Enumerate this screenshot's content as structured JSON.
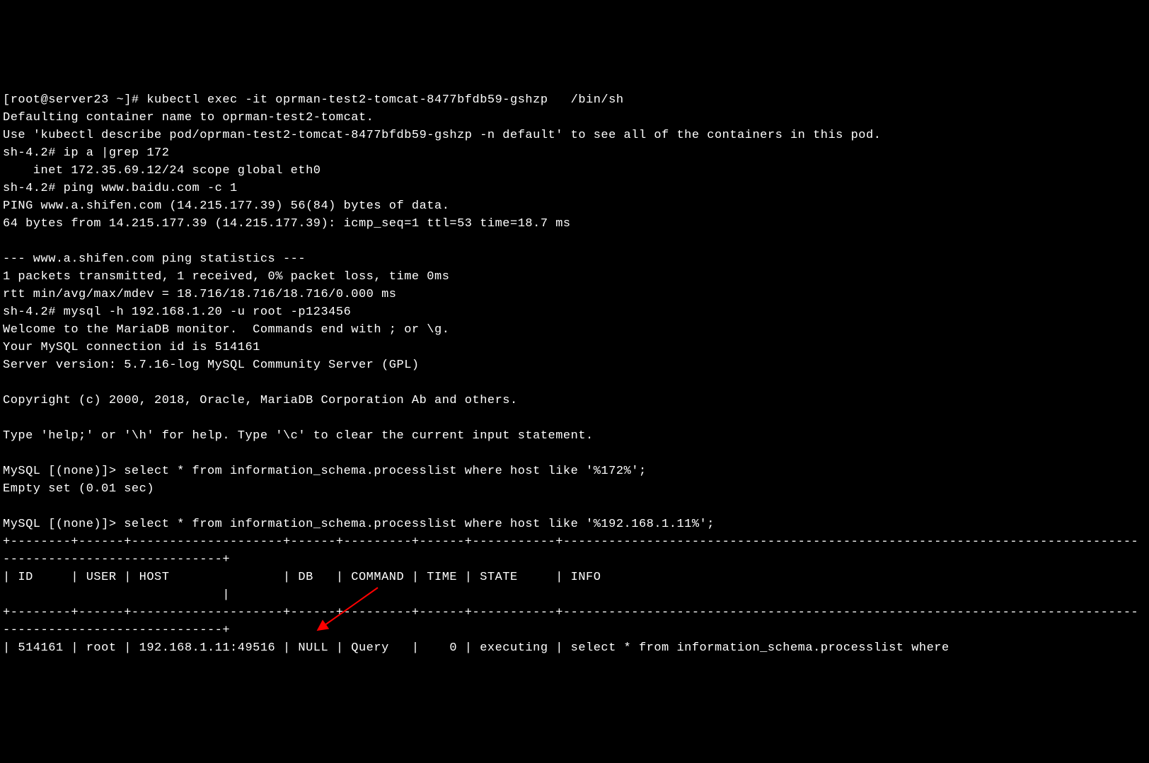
{
  "lines": {
    "l1": "[root@server23 ~]# kubectl exec -it oprman-test2-tomcat-8477bfdb59-gshzp   /bin/sh",
    "l2": "Defaulting container name to oprman-test2-tomcat.",
    "l3": "Use 'kubectl describe pod/oprman-test2-tomcat-8477bfdb59-gshzp -n default' to see all of the containers in this pod.",
    "l4": "sh-4.2# ip a |grep 172",
    "l5": "    inet 172.35.69.12/24 scope global eth0",
    "l6": "sh-4.2# ping www.baidu.com -c 1",
    "l7": "PING www.a.shifen.com (14.215.177.39) 56(84) bytes of data.",
    "l8": "64 bytes from 14.215.177.39 (14.215.177.39): icmp_seq=1 ttl=53 time=18.7 ms",
    "l9": "",
    "l10": "--- www.a.shifen.com ping statistics ---",
    "l11": "1 packets transmitted, 1 received, 0% packet loss, time 0ms",
    "l12": "rtt min/avg/max/mdev = 18.716/18.716/18.716/0.000 ms",
    "l13": "sh-4.2# mysql -h 192.168.1.20 -u root -p123456",
    "l14": "Welcome to the MariaDB monitor.  Commands end with ; or \\g.",
    "l15": "Your MySQL connection id is 514161",
    "l16": "Server version: 5.7.16-log MySQL Community Server (GPL)",
    "l17": "",
    "l18": "Copyright (c) 2000, 2018, Oracle, MariaDB Corporation Ab and others.",
    "l19": "",
    "l20": "Type 'help;' or '\\h' for help. Type '\\c' to clear the current input statement.",
    "l21": "",
    "l22": "MySQL [(none)]> select * from information_schema.processlist where host like '%172%';",
    "l23": "Empty set (0.01 sec)",
    "l24": "",
    "l25": "MySQL [(none)]> select * from information_schema.processlist where host like '%192.168.1.11%';",
    "l26": "+--------+------+--------------------+------+---------+------+-----------+----------------------------------------------------------------------------",
    "l27": "-----------------------------+",
    "l28": "| ID     | USER | HOST               | DB   | COMMAND | TIME | STATE     | INFO",
    "l29": "                             |",
    "l30": "+--------+------+--------------------+------+---------+------+-----------+----------------------------------------------------------------------------",
    "l31": "-----------------------------+",
    "l32": "| 514161 | root | 192.168.1.11:49516 | NULL | Query   |    0 | executing | select * from information_schema.processlist where"
  },
  "annotation": {
    "arrow_color": "#ff0000"
  }
}
